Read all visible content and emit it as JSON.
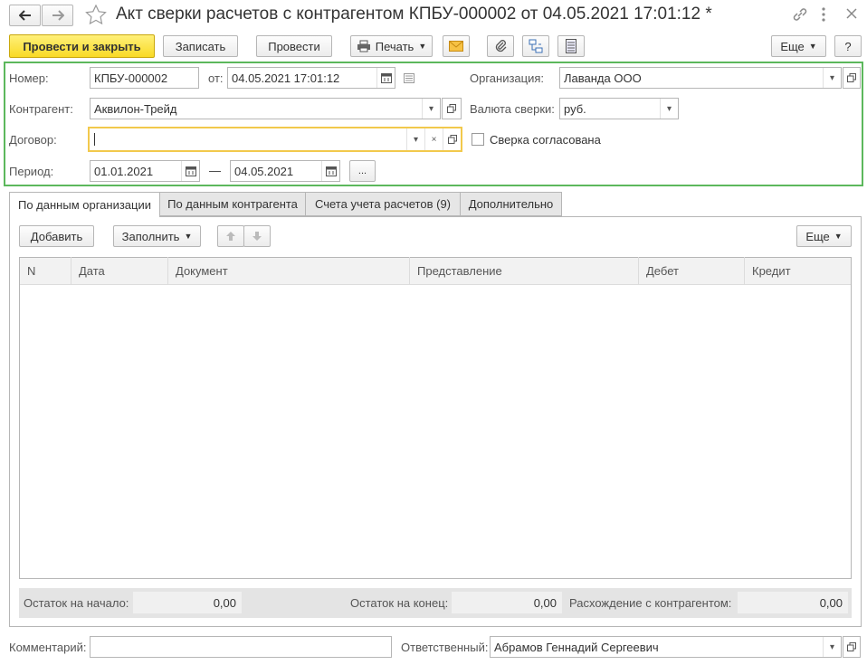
{
  "window": {
    "title": "Акт сверки расчетов с контрагентом КПБУ-000002 от 04.05.2021 17:01:12 *"
  },
  "toolbar": {
    "post_close": "Провести и закрыть",
    "save": "Записать",
    "post": "Провести",
    "print": "Печать",
    "more": "Еще",
    "help": "?"
  },
  "form": {
    "number_label": "Номер:",
    "number_value": "КПБУ-000002",
    "date_label": "от:",
    "date_value": "04.05.2021 17:01:12",
    "org_label": "Организация:",
    "org_value": "Лаванда ООО",
    "contractor_label": "Контрагент:",
    "contractor_value": "Аквилон-Трейд",
    "currency_label": "Валюта сверки:",
    "currency_value": "руб.",
    "contract_label": "Договор:",
    "contract_value": "",
    "agreed_label": "Сверка согласована",
    "agreed_checked": false,
    "period_label": "Период:",
    "period_from": "01.01.2021",
    "period_dash": "—",
    "period_to": "04.05.2021",
    "period_more": "..."
  },
  "tabs": [
    {
      "label": "По данным организации",
      "active": true
    },
    {
      "label": "По данным контрагента",
      "active": false
    },
    {
      "label": "Счета учета расчетов (9)",
      "active": false
    },
    {
      "label": "Дополнительно",
      "active": false
    }
  ],
  "table_toolbar": {
    "add": "Добавить",
    "fill": "Заполнить",
    "more": "Еще"
  },
  "table": {
    "columns": [
      "N",
      "Дата",
      "Документ",
      "Представление",
      "Дебет",
      "Кредит"
    ],
    "rows": []
  },
  "totals": {
    "start_label": "Остаток на начало:",
    "start_value": "0,00",
    "end_label": "Остаток на конец:",
    "end_value": "0,00",
    "diff_label": "Расхождение с контрагентом:",
    "diff_value": "0,00"
  },
  "bottom": {
    "comment_label": "Комментарий:",
    "comment_value": "",
    "responsible_label": "Ответственный:",
    "responsible_value": "Абрамов Геннадий Сергеевич"
  },
  "colors": {
    "accent_yellow": "#f9da25",
    "highlight_green": "#5cb85c",
    "focus_border": "#f2c94c"
  }
}
